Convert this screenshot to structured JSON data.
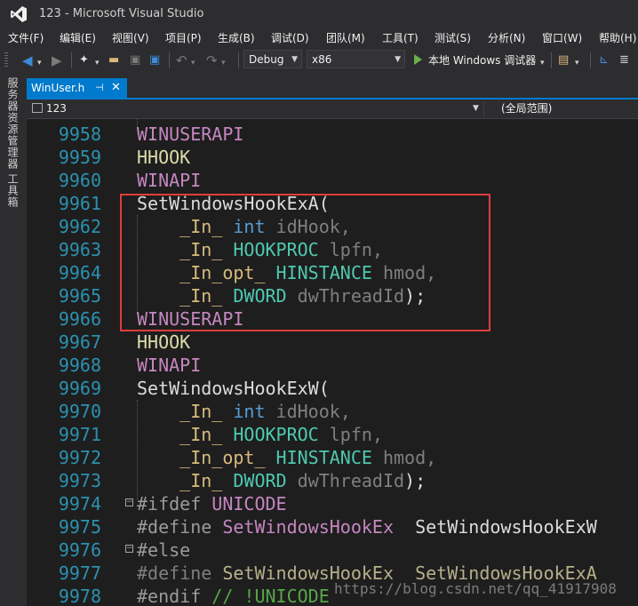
{
  "window": {
    "title": "123 - Microsoft Visual Studio"
  },
  "menu": [
    "文件(F)",
    "编辑(E)",
    "视图(V)",
    "项目(P)",
    "生成(B)",
    "调试(D)",
    "团队(M)",
    "工具(T)",
    "测试(S)",
    "分析(N)",
    "窗口(W)",
    "帮助(H)"
  ],
  "toolbar": {
    "config": "Debug",
    "platform": "x86",
    "run_label": "本地 Windows 调试器",
    "icons": [
      "back-icon",
      "forward-icon",
      "new-project-icon",
      "open-file-icon",
      "save-icon",
      "save-all-icon",
      "undo-icon",
      "redo-icon",
      "find-icon",
      "attach-icon"
    ]
  },
  "sidebar": {
    "tabs": [
      "服务器资源管理器",
      "工具箱"
    ]
  },
  "tabs": [
    {
      "label": "WinUser.h",
      "active": true
    }
  ],
  "navbar": {
    "project": "123",
    "scope": "(全局范围)"
  },
  "editor": {
    "lines": [
      {
        "num": "9958",
        "tokens": [
          {
            "t": "WINUSERAPI",
            "c": "#c586c0"
          }
        ]
      },
      {
        "num": "9959",
        "tokens": [
          {
            "t": "HHOOK",
            "c": "#dcdcaa"
          }
        ]
      },
      {
        "num": "9960",
        "tokens": [
          {
            "t": "WINAPI",
            "c": "#c586c0"
          }
        ]
      },
      {
        "num": "9961",
        "tokens": [
          {
            "t": "SetWindowsHookExA(",
            "c": "#dcdcdc"
          }
        ]
      },
      {
        "num": "9962",
        "tokens": [
          {
            "t": "    _In_ ",
            "c": "#d7ba7d"
          },
          {
            "t": "int",
            "c": "#569cd6"
          },
          {
            "t": " idHook,",
            "c": "#7f7f7f"
          }
        ]
      },
      {
        "num": "9963",
        "tokens": [
          {
            "t": "    _In_ ",
            "c": "#d7ba7d"
          },
          {
            "t": "HOOKPROC",
            "c": "#4ec9b0"
          },
          {
            "t": " lpfn,",
            "c": "#7f7f7f"
          }
        ]
      },
      {
        "num": "9964",
        "tokens": [
          {
            "t": "    _In_opt_ ",
            "c": "#d7ba7d"
          },
          {
            "t": "HINSTANCE",
            "c": "#4ec9b0"
          },
          {
            "t": " hmod,",
            "c": "#7f7f7f"
          }
        ]
      },
      {
        "num": "9965",
        "tokens": [
          {
            "t": "    _In_ ",
            "c": "#d7ba7d"
          },
          {
            "t": "DWORD",
            "c": "#4ec9b0"
          },
          {
            "t": " dwThreadId",
            "c": "#7f7f7f"
          },
          {
            "t": ");",
            "c": "#dcdcdc"
          }
        ]
      },
      {
        "num": "9966",
        "tokens": [
          {
            "t": "WINUSERAPI",
            "c": "#c586c0"
          }
        ]
      },
      {
        "num": "9967",
        "tokens": [
          {
            "t": "HHOOK",
            "c": "#dcdcaa"
          }
        ]
      },
      {
        "num": "9968",
        "tokens": [
          {
            "t": "WINAPI",
            "c": "#c586c0"
          }
        ]
      },
      {
        "num": "9969",
        "tokens": [
          {
            "t": "SetWindowsHookExW(",
            "c": "#dcdcdc"
          }
        ]
      },
      {
        "num": "9970",
        "tokens": [
          {
            "t": "    _In_ ",
            "c": "#d7ba7d"
          },
          {
            "t": "int",
            "c": "#569cd6"
          },
          {
            "t": " idHook,",
            "c": "#7f7f7f"
          }
        ]
      },
      {
        "num": "9971",
        "tokens": [
          {
            "t": "    _In_ ",
            "c": "#d7ba7d"
          },
          {
            "t": "HOOKPROC",
            "c": "#4ec9b0"
          },
          {
            "t": " lpfn,",
            "c": "#7f7f7f"
          }
        ]
      },
      {
        "num": "9972",
        "tokens": [
          {
            "t": "    _In_opt_ ",
            "c": "#d7ba7d"
          },
          {
            "t": "HINSTANCE",
            "c": "#4ec9b0"
          },
          {
            "t": " hmod,",
            "c": "#7f7f7f"
          }
        ]
      },
      {
        "num": "9973",
        "tokens": [
          {
            "t": "    _In_ ",
            "c": "#d7ba7d"
          },
          {
            "t": "DWORD",
            "c": "#4ec9b0"
          },
          {
            "t": " dwThreadId",
            "c": "#7f7f7f"
          },
          {
            "t": ");",
            "c": "#dcdcdc"
          }
        ]
      },
      {
        "num": "9974",
        "fold": "−",
        "tokens": [
          {
            "t": "#ifdef",
            "c": "#9b9b9b"
          },
          {
            "t": " UNICODE",
            "c": "#c586c0"
          }
        ]
      },
      {
        "num": "9975",
        "tokens": [
          {
            "t": "#define",
            "c": "#9b9b9b"
          },
          {
            "t": " SetWindowsHookEx",
            "c": "#c586c0"
          },
          {
            "t": "  SetWindowsHookExW",
            "c": "#dcdcdc"
          }
        ]
      },
      {
        "num": "9976",
        "fold": "−",
        "tokens": [
          {
            "t": "#else",
            "c": "#9b9b9b"
          }
        ]
      },
      {
        "num": "9977",
        "tokens": [
          {
            "t": "#define",
            "c": "#7f7f7f"
          },
          {
            "t": " SetWindowsHookEx",
            "c": "#b5b08a"
          },
          {
            "t": "  SetWindowsHookExA",
            "c": "#b5b08a"
          }
        ]
      },
      {
        "num": "9978",
        "tokens": [
          {
            "t": "#endif",
            "c": "#9b9b9b"
          },
          {
            "t": " // !UNICODE",
            "c": "#57a64a"
          }
        ]
      }
    ]
  },
  "watermark": "https://blog.csdn.net/qq_41917908",
  "colors": {
    "accent": "#007acc",
    "line_number": "#2b91af",
    "highlight_box": "#e03c3c"
  }
}
